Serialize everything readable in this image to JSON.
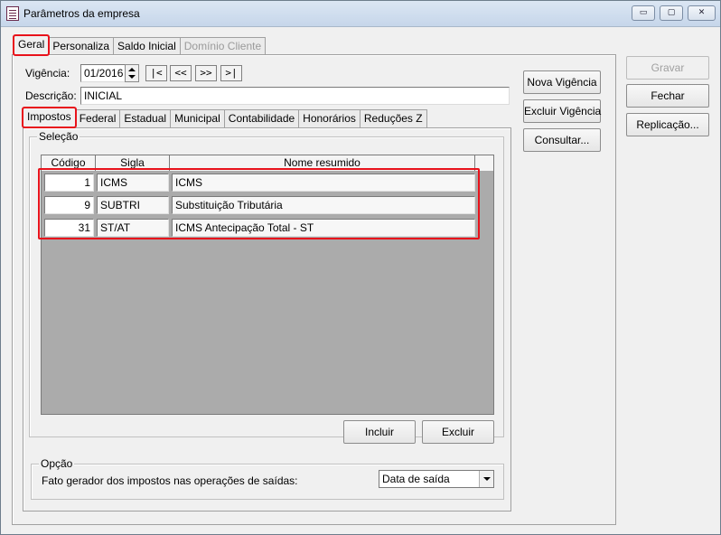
{
  "window": {
    "title": "Parâmetros da empresa",
    "controls": {
      "minimize": "▭",
      "maximize": "▢",
      "close": "✕"
    }
  },
  "main_tabs": [
    {
      "label": "Geral",
      "active": true,
      "enabled": true
    },
    {
      "label": "Personaliza",
      "active": false,
      "enabled": true
    },
    {
      "label": "Saldo Inicial",
      "active": false,
      "enabled": true
    },
    {
      "label": "Domínio Cliente",
      "active": false,
      "enabled": false
    }
  ],
  "vigencia": {
    "label": "Vigência:",
    "value": "01/2016",
    "nav": {
      "first": "|<",
      "prev": "<<",
      "next": ">>",
      "last": ">|"
    }
  },
  "descricao": {
    "label": "Descrição:",
    "value": "INICIAL"
  },
  "sub_tabs": [
    {
      "label": "Impostos",
      "active": true
    },
    {
      "label": "Federal",
      "active": false
    },
    {
      "label": "Estadual",
      "active": false
    },
    {
      "label": "Municipal",
      "active": false
    },
    {
      "label": "Contabilidade",
      "active": false
    },
    {
      "label": "Honorários",
      "active": false
    },
    {
      "label": "Reduções Z",
      "active": false
    }
  ],
  "selecao": {
    "title": "Seleção",
    "columns": [
      "Código",
      "Sigla",
      "Nome resumido"
    ],
    "rows": [
      {
        "codigo": "1",
        "sigla": "ICMS",
        "nome": "ICMS"
      },
      {
        "codigo": "9",
        "sigla": "SUBTRI",
        "nome": "Substituição Tributária"
      },
      {
        "codigo": "31",
        "sigla": "ST/AT",
        "nome": "ICMS Antecipação Total - ST"
      }
    ],
    "buttons": {
      "incluir": "Incluir",
      "excluir": "Excluir"
    }
  },
  "opcao": {
    "title": "Opção",
    "label": "Fato gerador dos impostos nas operações de saídas:",
    "selected": "Data de saída"
  },
  "middle_buttons": {
    "nova_vigencia": "Nova Vigência",
    "excluir_vigencia": "Excluir Vigência",
    "consultar": "Consultar..."
  },
  "right_buttons": {
    "gravar": "Gravar",
    "fechar": "Fechar",
    "replicacao": "Replicação..."
  },
  "colors": {
    "highlight": "#e8121b",
    "titlebar": "#c6d6ea"
  }
}
